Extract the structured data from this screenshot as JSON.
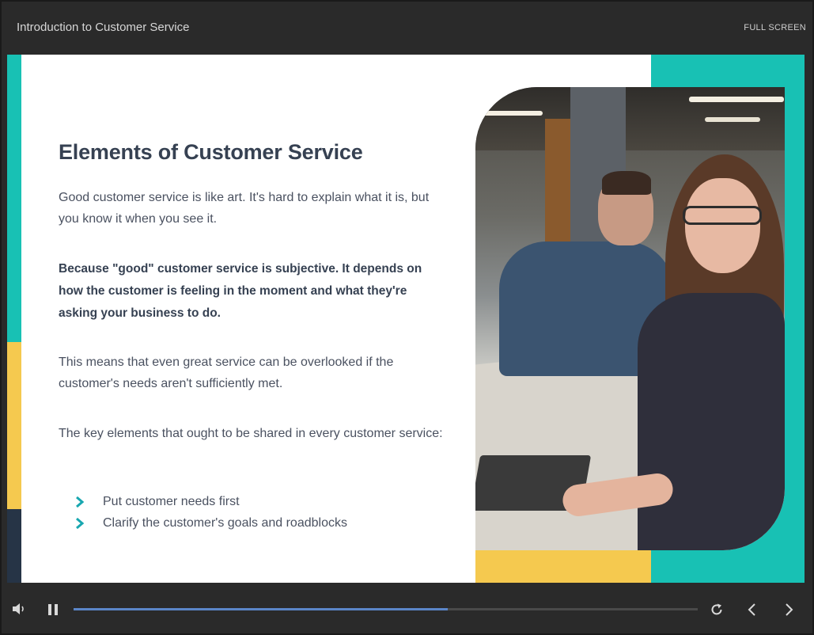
{
  "header": {
    "title": "Introduction to Customer Service",
    "fullscreen_label": "FULL SCREEN"
  },
  "slide": {
    "heading": "Elements of Customer Service",
    "paragraphs": [
      "Good customer service is like art. It's hard to explain what it is, but you know it when you see it.",
      "Because \"good\" customer service is subjective. It depends on how the customer is feeling in the moment and what they're asking your business to do.",
      "This means that even great service can be overlooked if the customer's needs aren't sufficiently met.",
      "The key elements that ought to be shared in every customer service:"
    ],
    "bullets": [
      "Put customer needs first",
      "Clarify the customer's goals and roadblocks"
    ],
    "colors": {
      "teal": "#18c1b4",
      "yellow": "#f5c94f",
      "navy": "#263446",
      "heading": "#364152"
    }
  },
  "player": {
    "progress": 0.6,
    "icons": [
      "volume-icon",
      "pause-icon",
      "replay-icon",
      "previous-icon",
      "next-icon"
    ]
  }
}
